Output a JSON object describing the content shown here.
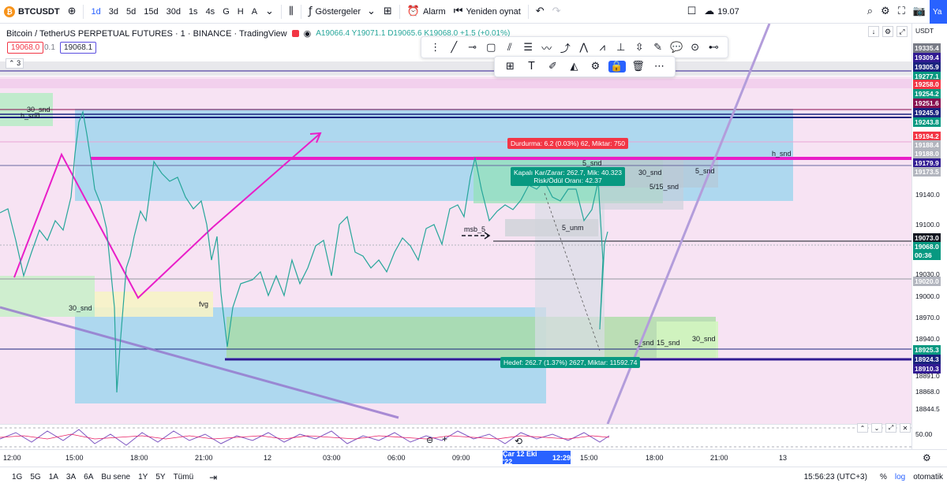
{
  "toolbar": {
    "symbol": "BTCUSDT",
    "btc_glyph": "₿",
    "add_icon": "plus-circle-icon",
    "timeframes": [
      "1d",
      "3d",
      "5d",
      "15d",
      "30d",
      "1s",
      "4s",
      "G",
      "H",
      "A"
    ],
    "active_timeframe": "1d",
    "indicators_label": "Göstergeler",
    "alert_label": "Alarm",
    "replay_label": "Yeniden oynat",
    "cloud_value": "19.07",
    "publish_label": "Ya"
  },
  "legend": {
    "title": "Bitcoin / TetherUS PERPETUAL FUTURES · 1 · BINANCE · TradingView",
    "ohlc": "A19066.4 Y19071.1 D19065.6 K19068.0 +1.5 (+0.01%)",
    "sell_price": "19068.0",
    "spread": "0.1",
    "buy_price": "19068.1",
    "collapse_count": "3"
  },
  "scale": {
    "currency": "USDT",
    "tags": [
      {
        "text": "19335.4",
        "color": "#787b86"
      },
      {
        "text": "19309.4",
        "color": "#311b92"
      },
      {
        "text": "19305.9",
        "color": "#1a237e"
      },
      {
        "text": "19277.1",
        "color": "#089981"
      },
      {
        "text": "19258.0",
        "color": "#f23645"
      },
      {
        "text": "19254.2",
        "color": "#089981"
      },
      {
        "text": "19251.6",
        "color": "#880e4f"
      },
      {
        "text": "19245.9",
        "color": "#1a237e"
      },
      {
        "text": "19243.8",
        "color": "#089981"
      },
      {
        "text": "19194.2",
        "color": "#f23645"
      },
      {
        "text": "19188.4",
        "color": "#b2b5be"
      },
      {
        "text": "19188.0",
        "color": "#b2b5be"
      },
      {
        "text": "19179.9",
        "color": "#311b92"
      },
      {
        "text": "19173.5",
        "color": "#b2b5be"
      },
      {
        "text": "19073.0",
        "color": "#131722"
      },
      {
        "text": "19068.0",
        "color": "#089981"
      },
      {
        "text": "00:36",
        "color": "#089981"
      },
      {
        "text": "19020.0",
        "color": "#b2b5be"
      },
      {
        "text": "18925.3",
        "color": "#089981"
      },
      {
        "text": "18924.3",
        "color": "#1a237e"
      },
      {
        "text": "18910.3",
        "color": "#311b92"
      }
    ],
    "ticks": [
      "19140.0",
      "19100.0",
      "19030.0",
      "19000.0",
      "18970.0",
      "18940.0",
      "18891.0",
      "18868.0",
      "18844.5"
    ],
    "osc_value": "50.00"
  },
  "chart_labels": {
    "snd_30_left": "30_snd",
    "h_snd_left": "h_snd",
    "snd_30_mid": "30_snd",
    "fvg": "fvg",
    "msb": "msb_5",
    "unm": "5_unm",
    "snd_5_top": "5_snd",
    "snd_30_top": "30_snd",
    "snd_5_right": "5_snd",
    "snd_515": "5/15_snd",
    "h_snd_right": "h_snd",
    "snd_5_bottom": "5_snd",
    "snd_15_bottom": "15_snd",
    "snd_30_bottom": "30_snd",
    "stop_tip": "Durdurma: 6.2 (0.03%) 62, Miktar: 750",
    "pnl_tip_1": "Kapalı Kar/Zarar: 262.7, Mik: 40.323",
    "pnl_tip_2": "Risk/Ödül Oranı: 42.37",
    "target_tip": "Hedef: 262.7 (1.37%) 2627, Miktar: 11592.74"
  },
  "time_axis": {
    "labels": [
      "12:00",
      "15:00",
      "18:00",
      "21:00",
      "12",
      "03:00",
      "06:00",
      "09:00",
      "15:00",
      "18:00",
      "21:00",
      "13"
    ],
    "cursor_date": "Çar 12 Eki '22",
    "cursor_time": "12:29"
  },
  "bottom": {
    "ranges": [
      "1G",
      "5G",
      "1A",
      "3A",
      "6A",
      "Bu sene",
      "1Y",
      "5Y",
      "Tümü"
    ],
    "clock": "15:56:23 (UTC+3)",
    "percent": "%",
    "log": "log",
    "auto": "otomatik"
  },
  "colors": {
    "accent": "#2962ff",
    "magenta": "#e91ec8",
    "navy": "#1a237e",
    "green_zone": "#a5e3b4",
    "cyan_zone": "#8fd3ec",
    "pink_zone": "#f4d7f0",
    "trend_purple": "#b39ddb"
  }
}
